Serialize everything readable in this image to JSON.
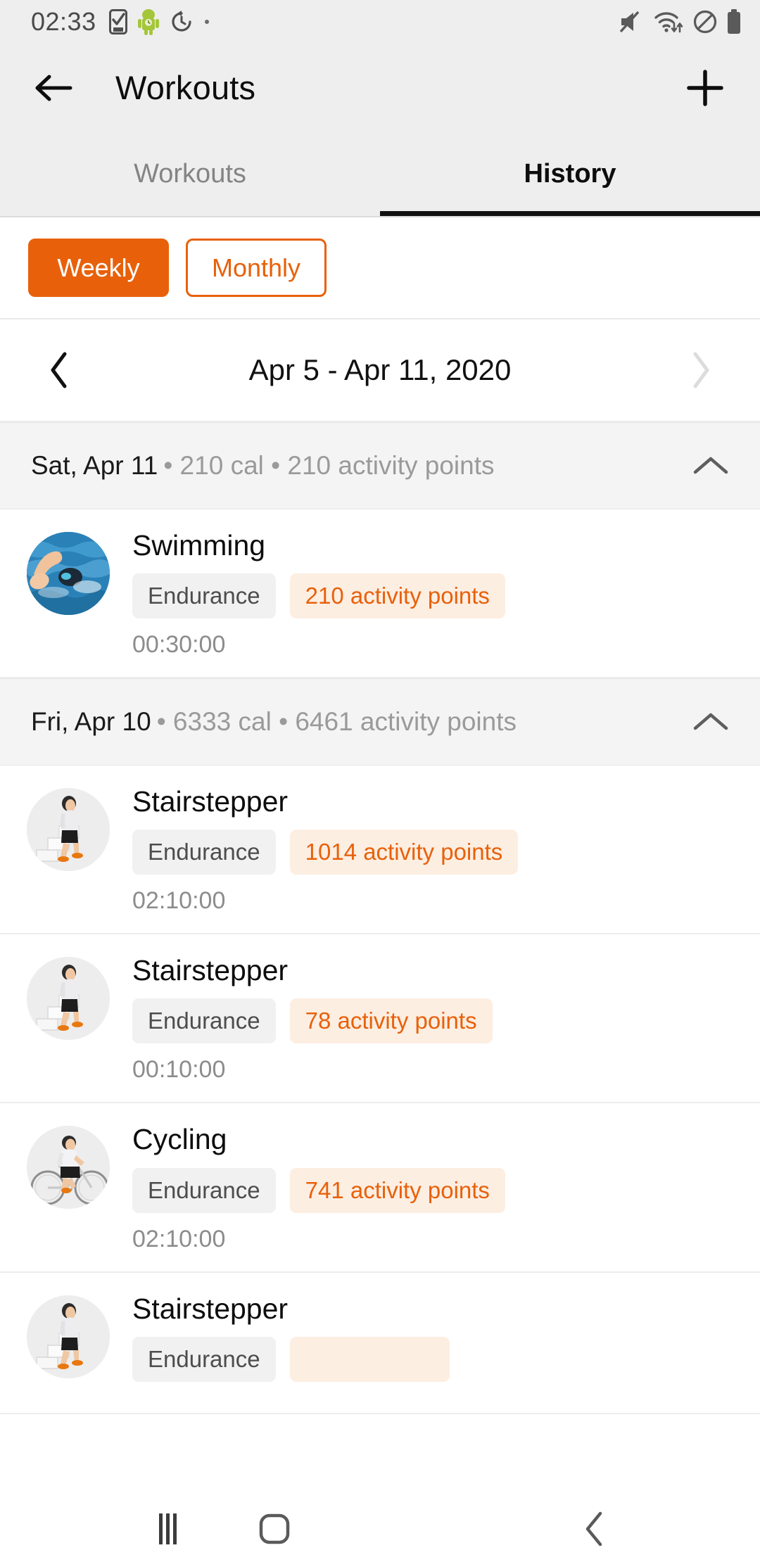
{
  "status_bar": {
    "time": "02:33",
    "left_icons": [
      "task-check-icon",
      "android-robot-icon",
      "timer-reset-icon",
      "dot-icon"
    ],
    "right_icons": [
      "volume-muted-icon",
      "wifi-data-icon",
      "do-not-disturb-icon",
      "battery-full-icon"
    ],
    "background": "#eeeeee"
  },
  "appbar": {
    "back_label": "back-arrow",
    "title": "Workouts",
    "add_label": "add"
  },
  "tabs": {
    "items": [
      {
        "label": "Workouts",
        "active": false
      },
      {
        "label": "History",
        "active": true
      }
    ]
  },
  "period_toggle": {
    "weekly_label": "Weekly",
    "monthly_label": "Monthly",
    "selected": "Weekly",
    "accent_color": "#e8610a"
  },
  "date_nav": {
    "prev_icon": "chevron-left-icon",
    "range_label": "Apr 5 - Apr 11, 2020",
    "next_icon": "chevron-right-icon",
    "next_disabled": true
  },
  "days": [
    {
      "title": "Sat, Apr 11",
      "meta": "• 210 cal • 210 activity points",
      "expanded": true,
      "collapse_icon": "chevron-up-icon",
      "workouts": [
        {
          "name": "Swimming",
          "type": "Endurance",
          "points": "210 activity points",
          "duration": "00:30:00",
          "thumb": "swimming-photo"
        }
      ]
    },
    {
      "title": "Fri, Apr 10",
      "meta": "• 6333 cal • 6461 activity points",
      "expanded": true,
      "collapse_icon": "chevron-up-icon",
      "workouts": [
        {
          "name": "Stairstepper",
          "type": "Endurance",
          "points": "1014 activity points",
          "duration": "02:10:00",
          "thumb": "stairstepper-illustration"
        },
        {
          "name": "Stairstepper",
          "type": "Endurance",
          "points": "78 activity points",
          "duration": "00:10:00",
          "thumb": "stairstepper-illustration"
        },
        {
          "name": "Cycling",
          "type": "Endurance",
          "points": "741 activity points",
          "duration": "02:10:00",
          "thumb": "cycling-illustration"
        },
        {
          "name": "Stairstepper",
          "type": "Endurance",
          "points": "",
          "duration": "",
          "thumb": "stairstepper-illustration"
        }
      ]
    }
  ],
  "nav_bar": {
    "recents": "recents-icon",
    "home": "home-icon",
    "back": "back-icon"
  }
}
